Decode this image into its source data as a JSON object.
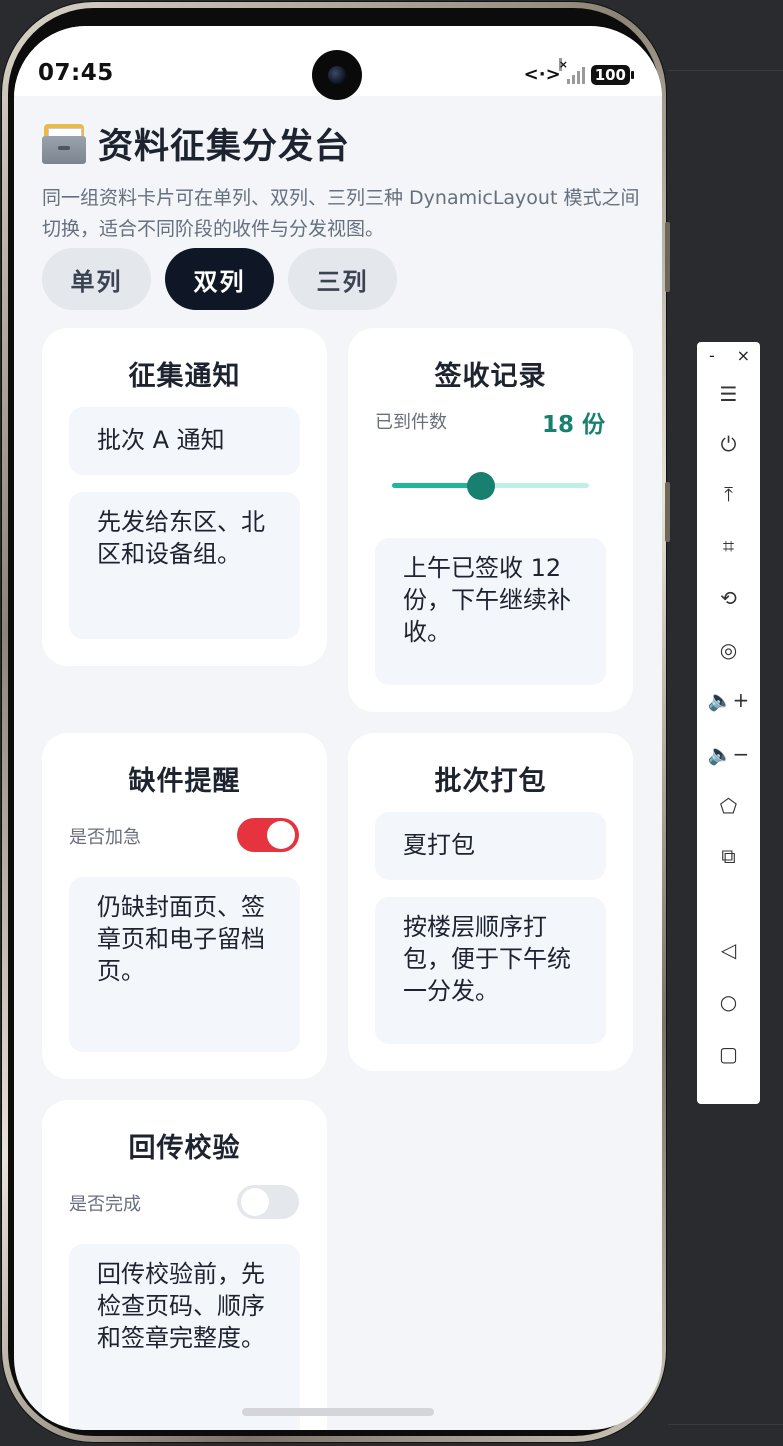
{
  "status_bar": {
    "time": "07:45",
    "network_icon": "<·>",
    "signal_x": "×",
    "battery": "100"
  },
  "header": {
    "icon": "file-cabinet-icon",
    "title": "资料征集分发台",
    "subtitle": "同一组资料卡片可在单列、双列、三列三种 DynamicLayout 模式之间切换，适合不同阶段的收件与分发视图。"
  },
  "layout_tabs": {
    "selected": "双列",
    "items": [
      {
        "label": "单列"
      },
      {
        "label": "双列"
      },
      {
        "label": "三列"
      }
    ]
  },
  "cards": {
    "notice": {
      "title": "征集通知",
      "field_value": "批次 A 通知",
      "note": "先发给东区、北区和设备组。"
    },
    "receipt": {
      "title": "签收记录",
      "label": "已到件数",
      "value_text": "18 份",
      "slider_fraction": 0.45,
      "note": "上午已签收 12 份，下午继续补收。"
    },
    "missing": {
      "title": "缺件提醒",
      "toggle_label": "是否加急",
      "toggle_on": true,
      "note": "仍缺封面页、签章页和电子留档页。"
    },
    "packing": {
      "title": "批次打包",
      "field_value": "夏打包",
      "note": "按楼层顺序打包，便于下午统一分发。"
    },
    "verify": {
      "title": "回传校验",
      "toggle_label": "是否完成",
      "toggle_on": false,
      "note": "回传校验前，先检查页码、顺序和签章完整度。"
    }
  },
  "emulator_toolbar": {
    "minimize": "-",
    "close": "×",
    "items": [
      {
        "name": "menu-icon",
        "glyph": "☰"
      },
      {
        "name": "power-icon",
        "glyph": "⏻"
      },
      {
        "name": "pin-top-icon",
        "glyph": "⤒"
      },
      {
        "name": "crop-icon",
        "glyph": "⌗"
      },
      {
        "name": "rotate-icon",
        "glyph": "⟲"
      },
      {
        "name": "screenshot-icon",
        "glyph": "◎"
      },
      {
        "name": "volume-up-icon",
        "glyph": "🔈+"
      },
      {
        "name": "volume-down-icon",
        "glyph": "🔈−"
      },
      {
        "name": "shake-icon",
        "glyph": "⬠"
      },
      {
        "name": "multi-device-icon",
        "glyph": "⧉"
      },
      {
        "name": "back-icon",
        "glyph": "◁"
      },
      {
        "name": "home-icon",
        "glyph": "○"
      },
      {
        "name": "recents-icon",
        "glyph": "▢"
      }
    ]
  }
}
